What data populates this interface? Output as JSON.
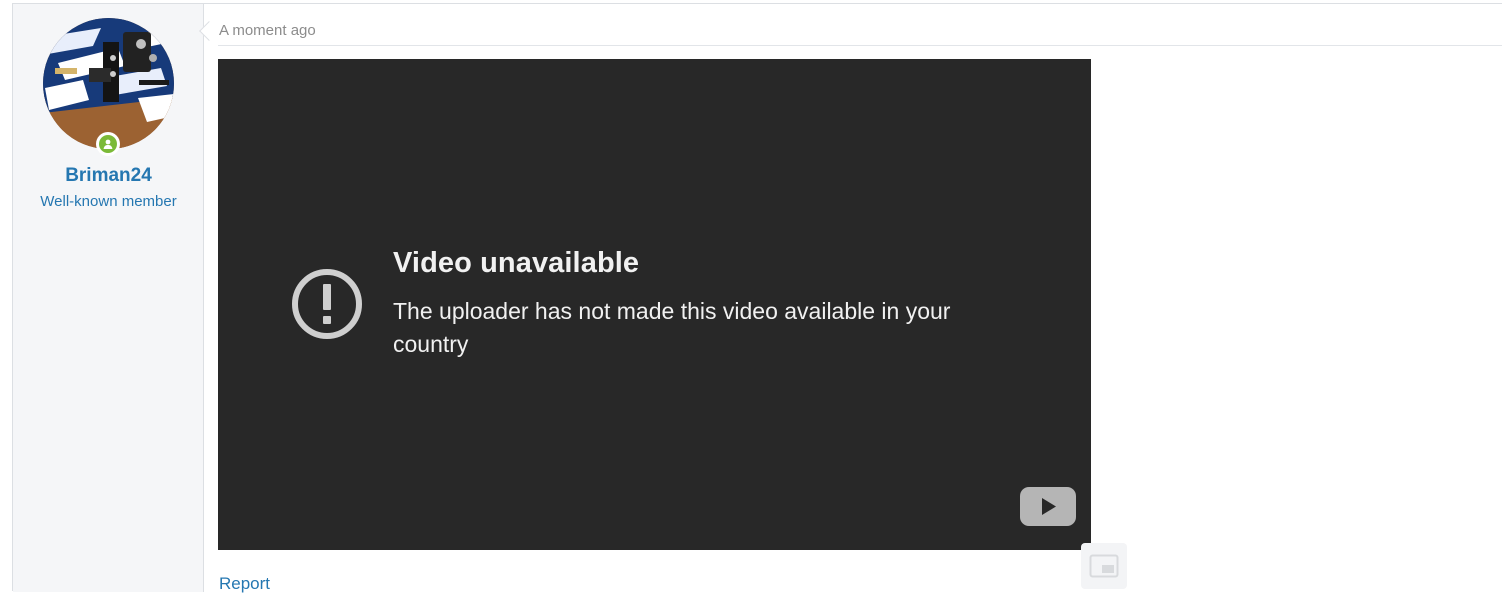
{
  "post": {
    "user": {
      "name": "Briman24",
      "title": "Well-known member",
      "status": "online",
      "avatar_icon": "avatar-image"
    },
    "time": "A moment ago",
    "video": {
      "error_title": "Video unavailable",
      "error_message": "The uploader has not made this video available in your country",
      "icons": {
        "error": "exclamation-circle-icon",
        "logo": "youtube-play-icon"
      }
    },
    "report_label": "Report"
  },
  "colors": {
    "link": "#2577b1",
    "online": "#7bba38",
    "video_bg": "#282828",
    "video_text": "#f1f1f1",
    "sidebar_bg": "#f5f6f8",
    "muted_text": "#8c8c8c"
  }
}
